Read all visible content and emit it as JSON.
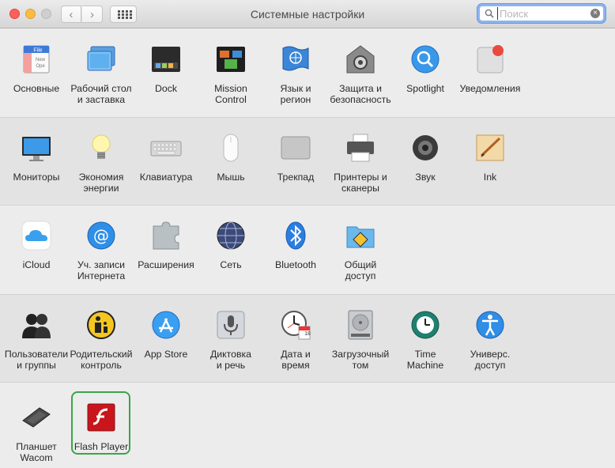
{
  "window": {
    "title": "Системные настройки",
    "search": {
      "placeholder": "Поиск",
      "value": ""
    }
  },
  "colors": {
    "highlight": "#3aa548",
    "accent": "#3b82f6"
  },
  "sections": [
    {
      "items": [
        {
          "label": "Основные",
          "icon": "general-icon"
        },
        {
          "label": "Рабочий стол\nи заставка",
          "icon": "desktop-icon"
        },
        {
          "label": "Dock",
          "icon": "dock-icon"
        },
        {
          "label": "Mission\nControl",
          "icon": "mission-control-icon"
        },
        {
          "label": "Язык и\nрегион",
          "icon": "language-region-icon"
        },
        {
          "label": "Защита и\nбезопасность",
          "icon": "security-icon"
        },
        {
          "label": "Spotlight",
          "icon": "spotlight-icon"
        },
        {
          "label": "Уведомления",
          "icon": "notifications-icon"
        }
      ]
    },
    {
      "items": [
        {
          "label": "Мониторы",
          "icon": "displays-icon"
        },
        {
          "label": "Экономия\nэнергии",
          "icon": "energy-icon"
        },
        {
          "label": "Клавиатура",
          "icon": "keyboard-icon"
        },
        {
          "label": "Мышь",
          "icon": "mouse-icon"
        },
        {
          "label": "Трекпад",
          "icon": "trackpad-icon"
        },
        {
          "label": "Принтеры и\nсканеры",
          "icon": "printers-icon"
        },
        {
          "label": "Звук",
          "icon": "sound-icon"
        },
        {
          "label": "Ink",
          "icon": "ink-icon"
        }
      ]
    },
    {
      "items": [
        {
          "label": "iCloud",
          "icon": "icloud-icon"
        },
        {
          "label": "Уч. записи\nИнтернета",
          "icon": "internet-accounts-icon"
        },
        {
          "label": "Расширения",
          "icon": "extensions-icon"
        },
        {
          "label": "Сеть",
          "icon": "network-icon"
        },
        {
          "label": "Bluetooth",
          "icon": "bluetooth-icon"
        },
        {
          "label": "Общий\nдоступ",
          "icon": "sharing-icon"
        }
      ]
    },
    {
      "items": [
        {
          "label": "Пользователи\nи группы",
          "icon": "users-icon"
        },
        {
          "label": "Родительский\nконтроль",
          "icon": "parental-controls-icon"
        },
        {
          "label": "App Store",
          "icon": "app-store-icon"
        },
        {
          "label": "Диктовка\nи речь",
          "icon": "dictation-icon"
        },
        {
          "label": "Дата и\nвремя",
          "icon": "date-time-icon",
          "date_day": "18"
        },
        {
          "label": "Загрузочный\nтом",
          "icon": "startup-disk-icon"
        },
        {
          "label": "Time\nMachine",
          "icon": "time-machine-icon"
        },
        {
          "label": "Универс.\nдоступ",
          "icon": "accessibility-icon"
        }
      ]
    },
    {
      "items": [
        {
          "label": "Планшет Wacom",
          "icon": "wacom-icon"
        },
        {
          "label": "Flash Player",
          "icon": "flash-icon",
          "highlighted": true
        }
      ]
    }
  ]
}
